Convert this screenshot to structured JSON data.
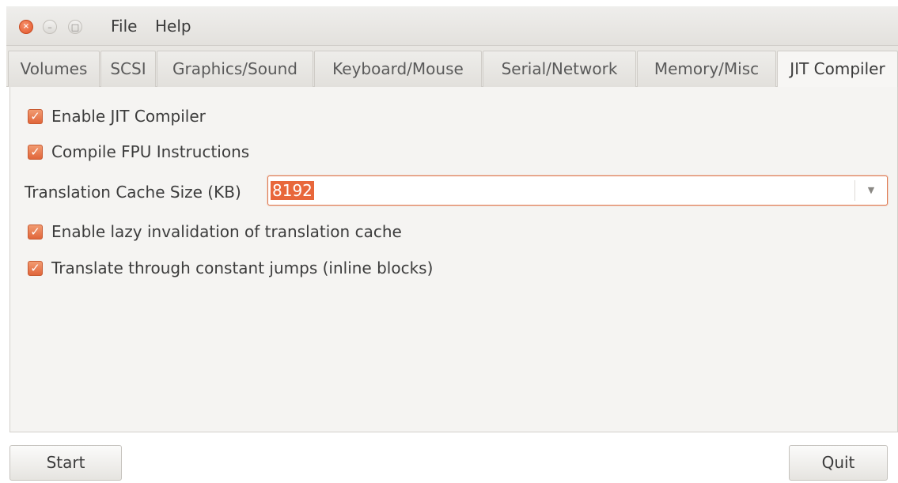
{
  "menu": {
    "file": "File",
    "help": "Help"
  },
  "window_controls": {
    "close": "×",
    "minimize": "–",
    "maximize": "□"
  },
  "tabs": [
    {
      "label": "Volumes",
      "active": false
    },
    {
      "label": "SCSI",
      "active": false
    },
    {
      "label": "Graphics/Sound",
      "active": false
    },
    {
      "label": "Keyboard/Mouse",
      "active": false
    },
    {
      "label": "Serial/Network",
      "active": false
    },
    {
      "label": "Memory/Misc",
      "active": false
    },
    {
      "label": "JIT Compiler",
      "active": true
    }
  ],
  "jit": {
    "enable_jit": {
      "label": "Enable JIT Compiler",
      "checked": true
    },
    "compile_fpu": {
      "label": "Compile FPU Instructions",
      "checked": true
    },
    "cache_size": {
      "label": "Translation Cache Size (KB)",
      "value": "8192",
      "dropdown_icon": "chevron-down-icon"
    },
    "lazy_invalidation": {
      "label": "Enable lazy invalidation of translation cache",
      "checked": true
    },
    "inline_blocks": {
      "label": "Translate through constant jumps (inline blocks)",
      "checked": true
    }
  },
  "buttons": {
    "start": "Start",
    "quit": "Quit"
  },
  "colors": {
    "accent": "#e8673b",
    "checkbox": "#e0653a"
  }
}
